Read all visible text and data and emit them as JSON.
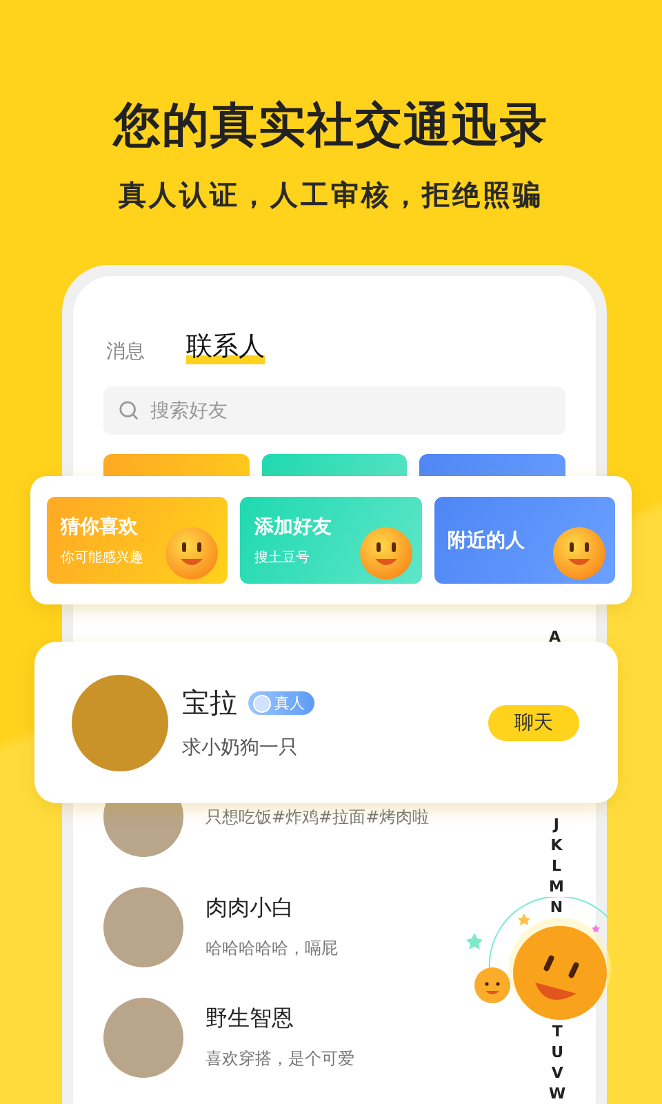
{
  "headline": {
    "title": "您的真实社交通迅录",
    "subtitle": "真人认证，人工审核，拒绝照骗"
  },
  "tabs": [
    {
      "label": "消息",
      "selected": false
    },
    {
      "label": "联系人",
      "selected": true
    }
  ],
  "search": {
    "placeholder": "搜索好友"
  },
  "feature_cards": [
    {
      "kind": "like",
      "title": "猜你喜欢",
      "subtitle": "你可能感兴趣"
    },
    {
      "kind": "add",
      "title": "添加好友",
      "subtitle": "搜土豆号"
    },
    {
      "kind": "nearby",
      "title": "附近的人"
    }
  ],
  "featured_contact": {
    "name": "宝拉",
    "badge": "真人",
    "status": "求小奶狗一只",
    "button": "聊天"
  },
  "contacts": [
    {
      "status": "只想吃饭#炸鸡#拉面#烤肉啦"
    },
    {
      "name": "肉肉小白",
      "status": "哈哈哈哈哈，嗝屁"
    },
    {
      "name": "野生智恩",
      "status": "喜欢穿搭，是个可爱"
    }
  ],
  "index_letters": {
    "top": [
      "A"
    ],
    "middle": [
      "J",
      "K",
      "L",
      "M",
      "N"
    ],
    "bottom": [
      "T",
      "U",
      "V",
      "W"
    ]
  }
}
